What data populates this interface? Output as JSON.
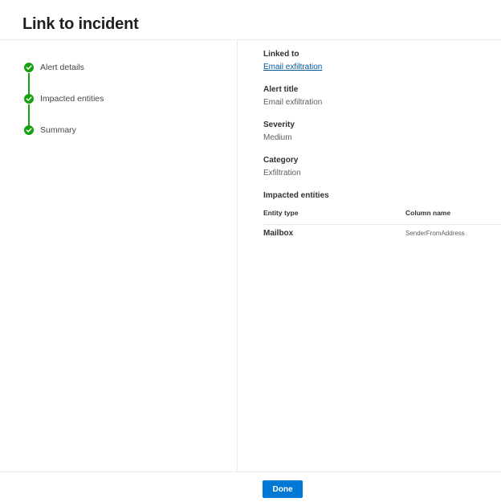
{
  "panel": {
    "title": "Link to incident"
  },
  "steps": [
    {
      "label": "Alert details",
      "status": "completed"
    },
    {
      "label": "Impacted entities",
      "status": "completed"
    },
    {
      "label": "Summary",
      "status": "completed"
    }
  ],
  "summary": {
    "linked_to": {
      "label": "Linked to",
      "value": "Email exfiltration"
    },
    "alert_title": {
      "label": "Alert title",
      "value": "Email exfiltration"
    },
    "severity": {
      "label": "Severity",
      "value": "Medium"
    },
    "category": {
      "label": "Category",
      "value": "Exfiltration"
    },
    "impacted_entities": {
      "label": "Impacted entities",
      "columns": [
        "Entity type",
        "Column name"
      ],
      "rows": [
        {
          "entity_type": "Mailbox",
          "column_name": "SenderFromAddress"
        }
      ]
    }
  },
  "footer": {
    "done_label": "Done"
  },
  "colors": {
    "accent": "#0078d4",
    "success": "#13a10e",
    "link": "#005a9e"
  },
  "icons": {
    "step_status": "checkmark-circle-icon"
  }
}
